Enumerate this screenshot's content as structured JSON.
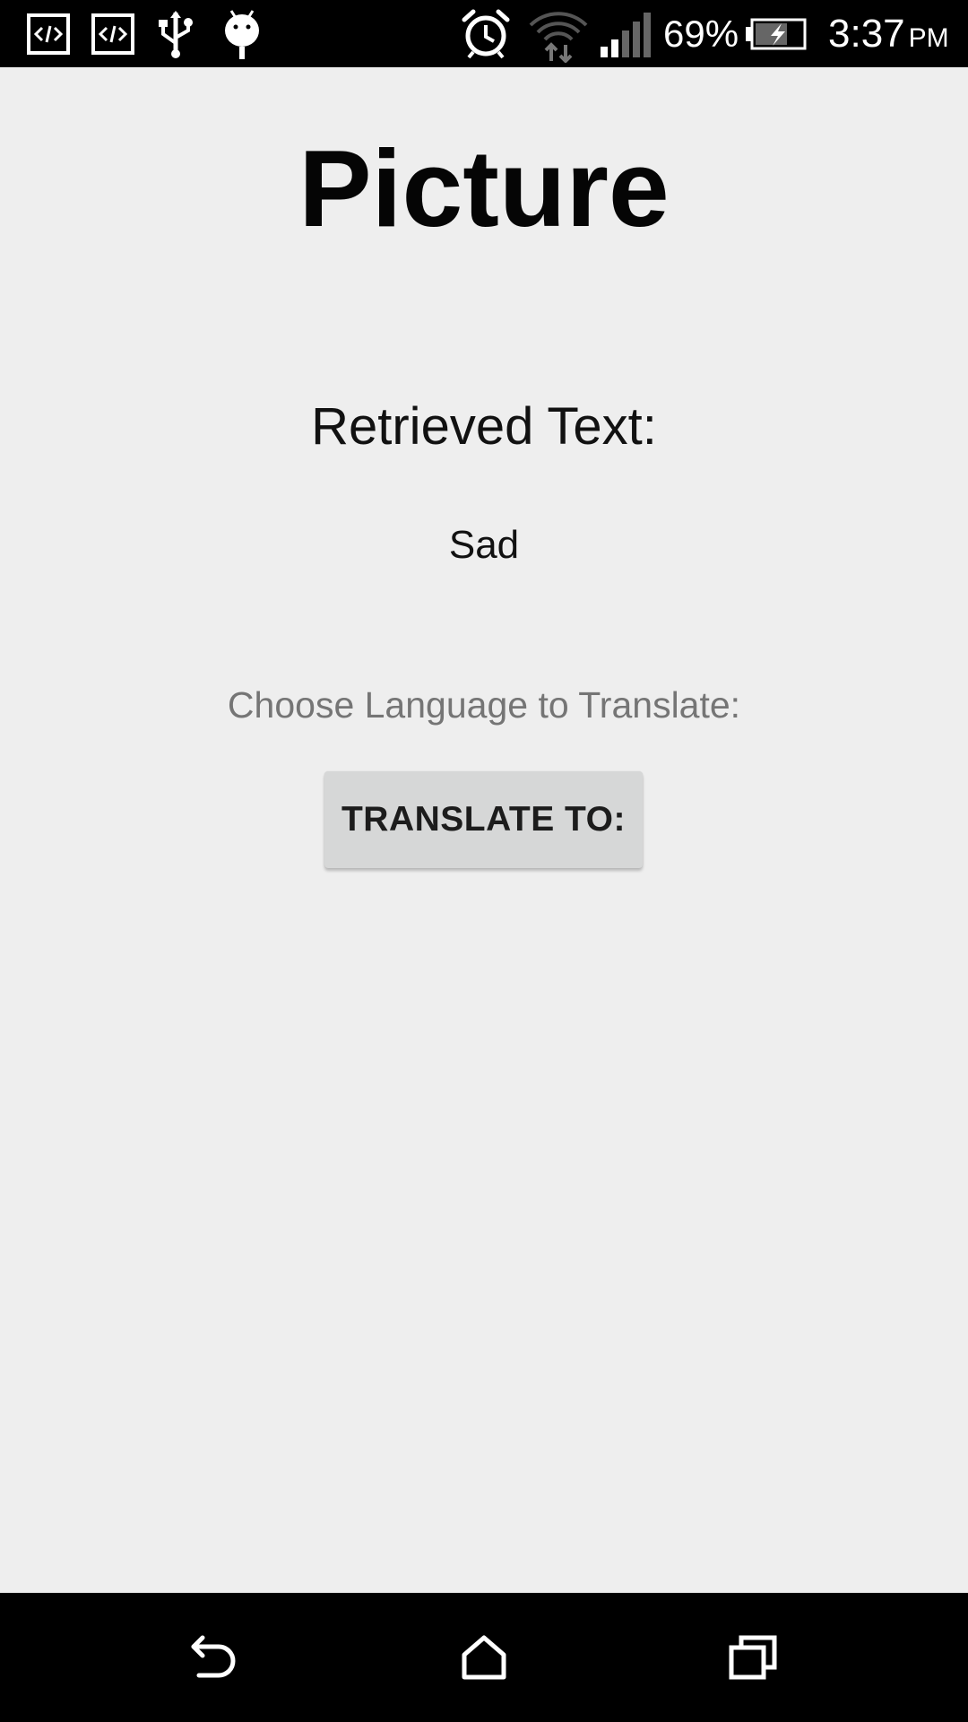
{
  "status_bar": {
    "icons": [
      "code-icon",
      "code-icon",
      "usb-icon",
      "android-debug-icon",
      "alarm-icon",
      "wifi-icon",
      "signal-icon",
      "battery-charging-icon"
    ],
    "battery_percent": "69%",
    "time": "3:37",
    "ampm": "PM"
  },
  "main": {
    "title": "Picture",
    "retrieved_label": "Retrieved Text:",
    "retrieved_value": "Sad",
    "choose_label": "Choose Language to Translate:",
    "translate_button": "TRANSLATE TO:"
  },
  "nav_bar": {
    "icons": [
      "back-icon",
      "home-icon",
      "recents-icon"
    ]
  },
  "colors": {
    "background": "#eeeeee",
    "button": "#d6d7d7",
    "secondary_text": "#757575",
    "bars": "#000000"
  }
}
